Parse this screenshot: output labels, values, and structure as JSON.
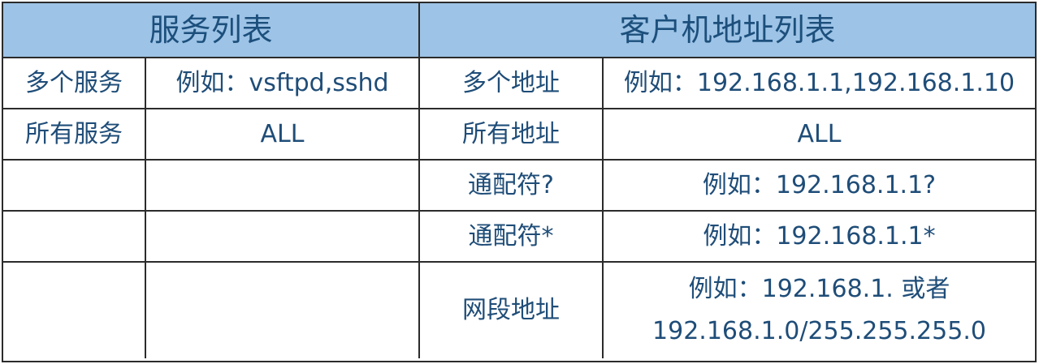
{
  "table": {
    "headers": [
      "服务列表",
      "客户机地址列表"
    ],
    "rows": [
      {
        "service_type": "多个服务",
        "service_example": "例如：vsftpd,sshd",
        "address_type": "多个地址",
        "address_example": "例如：192.168.1.1,192.168.1.10"
      },
      {
        "service_type": "所有服务",
        "service_example": "ALL",
        "address_type": "所有地址",
        "address_example": "ALL"
      },
      {
        "service_type": "",
        "service_example": "",
        "address_type": "通配符?",
        "address_example": "例如：192.168.1.1?"
      },
      {
        "service_type": "",
        "service_example": "",
        "address_type": "通配符*",
        "address_example": "例如：192.168.1.1*"
      },
      {
        "service_type": "",
        "service_example": "",
        "address_type": "网段地址",
        "address_example_lines": [
          "例如：192.168.1. 或者",
          "192.168.1.0/255.255.255.0"
        ]
      }
    ]
  }
}
